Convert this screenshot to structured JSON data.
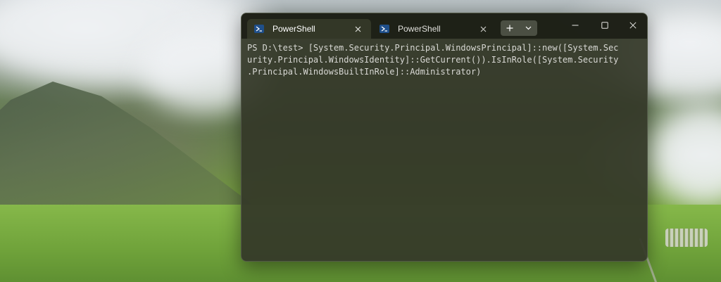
{
  "terminal": {
    "tabs": [
      {
        "label": "PowerShell",
        "active": true,
        "icon": "powershell-icon"
      },
      {
        "label": "PowerShell",
        "active": false,
        "icon": "powershell-icon"
      }
    ],
    "tab_close_icon": "close-icon",
    "new_tab_icon": "plus-icon",
    "dropdown_icon": "chevron-down-icon",
    "window_controls": [
      "minimize-icon",
      "maximize-icon",
      "close-icon"
    ],
    "console_lines": [
      "PS D:\\test> [System.Security.Principal.WindowsPrincipal]::new([System.Sec",
      "urity.Principal.WindowsIdentity]::GetCurrent()).IsInRole([System.Security",
      ".Principal.WindowsBuiltInRole]::Administrator)"
    ],
    "colors": {
      "console_background": "#343828",
      "tabbar_background": "#1c1e16",
      "text": "#d8d8d4",
      "powershell_icon": "#1f4f8a"
    }
  }
}
